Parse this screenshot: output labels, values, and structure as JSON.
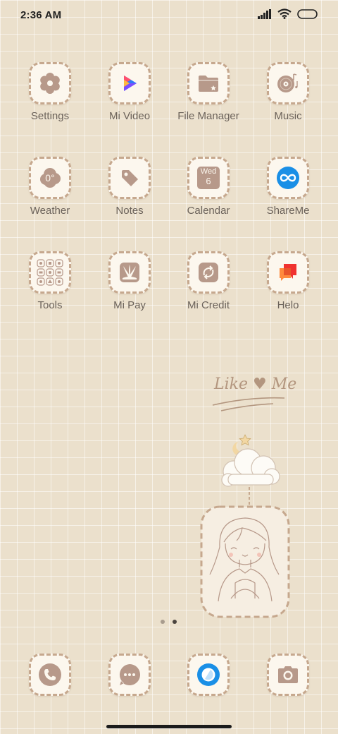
{
  "status_bar": {
    "time": "2:36 AM",
    "icons": [
      "signal-icon",
      "wifi-icon",
      "battery-icon"
    ]
  },
  "apps": {
    "settings": {
      "label": "Settings",
      "icon": "gear-icon"
    },
    "mi_video": {
      "label": "Mi Video",
      "icon": "play-icon"
    },
    "file_manager": {
      "label": "File Manager",
      "icon": "folder-icon"
    },
    "music": {
      "label": "Music",
      "icon": "vinyl-record-icon"
    },
    "weather": {
      "label": "Weather",
      "icon": "cloud-icon",
      "temp": "0°"
    },
    "notes": {
      "label": "Notes",
      "icon": "tag-icon"
    },
    "calendar": {
      "label": "Calendar",
      "icon": "calendar-icon",
      "day": "Wed",
      "date": "6"
    },
    "shareme": {
      "label": "ShareMe",
      "icon": "infinity-icon"
    },
    "tools": {
      "label": "Tools",
      "icon": "tools-grid-icon"
    },
    "mi_pay": {
      "label": "Mi Pay",
      "icon": "leaf-fan-icon"
    },
    "mi_credit": {
      "label": "Mi Credit",
      "icon": "refresh-arrows-icon"
    },
    "helo": {
      "label": "Helo",
      "icon": "chat-bubbles-icon"
    }
  },
  "dock": [
    "phone-icon",
    "messages-icon",
    "browser-icon",
    "camera-icon"
  ],
  "pager": {
    "pages": 2,
    "current": 2
  },
  "widget": {
    "text": "Like ♥ Me"
  },
  "colors": {
    "background": "#ebe0cc",
    "tile_border": "#c6a88e",
    "icon_brown": "#b7998a",
    "label": "#6b625a"
  }
}
